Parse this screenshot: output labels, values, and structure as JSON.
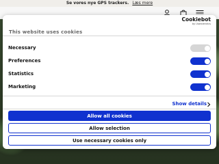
{
  "announcement": {
    "text": "Se vores nye GPS trackers.",
    "link": "Læs mere"
  },
  "header": {
    "icons": [
      "account-icon",
      "bag-icon",
      "menu-icon"
    ]
  },
  "consent": {
    "title": "This website uses cookies",
    "logo": {
      "name": "Cookiebot",
      "tagline": "by Usercentrics"
    },
    "categories": [
      {
        "label": "Necessary",
        "enabled": true,
        "locked": true
      },
      {
        "label": "Preferences",
        "enabled": true,
        "locked": false
      },
      {
        "label": "Statistics",
        "enabled": true,
        "locked": false
      },
      {
        "label": "Marketing",
        "enabled": true,
        "locked": false
      }
    ],
    "show_details": "Show details",
    "buttons": {
      "allow_all": "Allow all cookies",
      "allow_selection": "Allow selection",
      "necessary_only": "Use necessary cookies only"
    }
  },
  "colors": {
    "accent": "#1032cf",
    "disabled_toggle": "#d6d6d6"
  }
}
